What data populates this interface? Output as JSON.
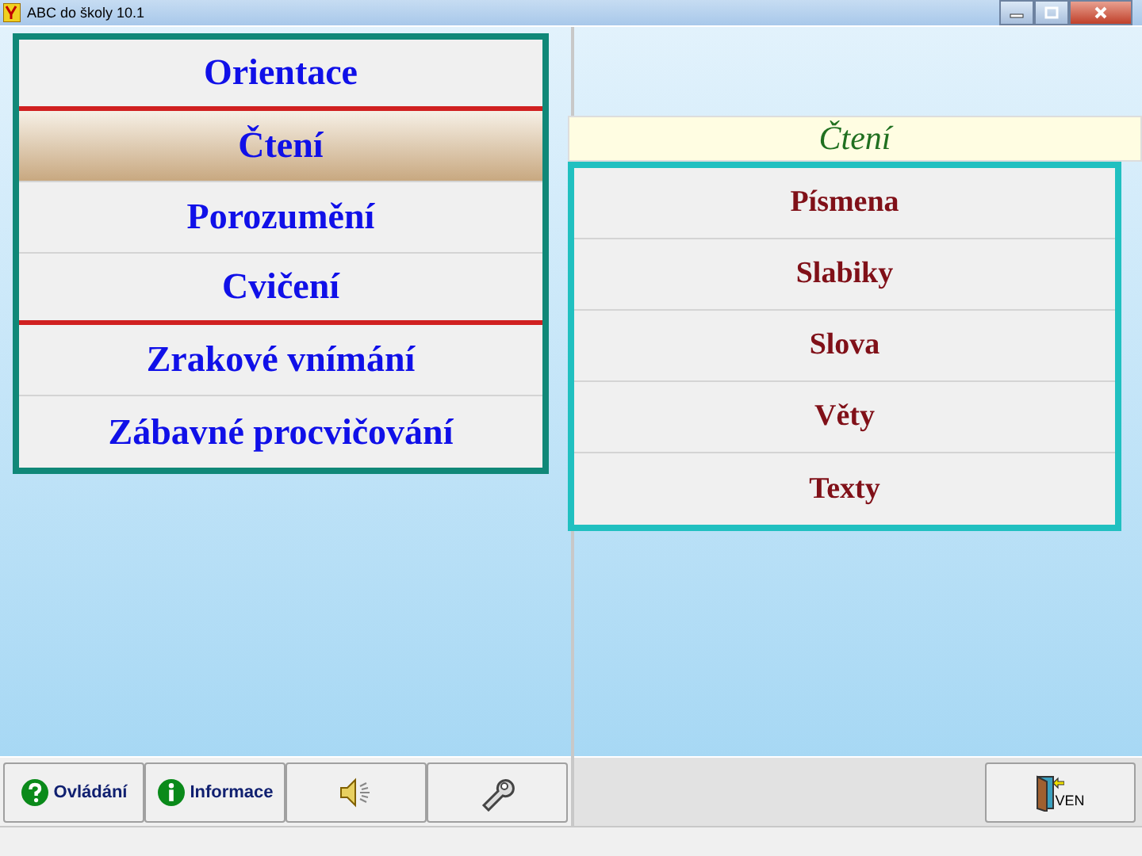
{
  "window": {
    "title": "ABC do školy 10.1"
  },
  "menu": [
    {
      "label": "Orientace",
      "selected": false,
      "separator_after": true
    },
    {
      "label": "Čtení",
      "selected": true,
      "separator_after": false
    },
    {
      "label": "Porozumění",
      "selected": false,
      "separator_after": false
    },
    {
      "label": "Cvičení",
      "selected": false,
      "separator_after": true
    },
    {
      "label": "Zrakové vnímání",
      "selected": false,
      "separator_after": false
    },
    {
      "label": "Zábavné procvičování",
      "selected": false,
      "separator_after": false
    }
  ],
  "submenu": {
    "title": "Čtení",
    "items": [
      "Písmena",
      "Slabiky",
      "Slova",
      "Věty",
      "Texty"
    ]
  },
  "toolbar": [
    {
      "kind": "help",
      "label": "Ovládání"
    },
    {
      "kind": "info",
      "label": "Informace"
    },
    {
      "kind": "sound"
    },
    {
      "kind": "settings"
    }
  ],
  "exit_button": {
    "label": "VEN"
  }
}
